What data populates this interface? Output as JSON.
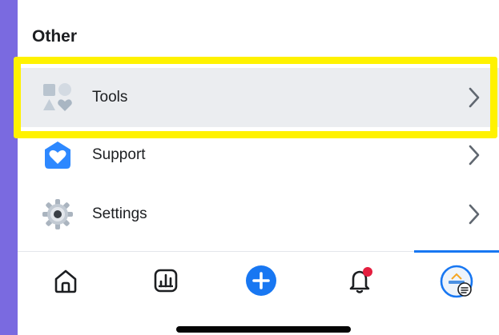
{
  "section": {
    "title": "Other"
  },
  "menu": [
    {
      "label": "Tools",
      "icon": "tools-shapes-icon"
    },
    {
      "label": "Support",
      "icon": "support-heart-house-icon"
    },
    {
      "label": "Settings",
      "icon": "settings-gear-icon"
    }
  ],
  "tabbar": {
    "tabs": [
      {
        "name": "home",
        "icon": "home-icon"
      },
      {
        "name": "insights",
        "icon": "insights-chart-icon"
      },
      {
        "name": "create",
        "icon": "plus-circle-icon"
      },
      {
        "name": "notifications",
        "icon": "bell-icon",
        "badge": true
      },
      {
        "name": "profile",
        "icon": "profile-avatar-icon",
        "active": true
      }
    ]
  },
  "colors": {
    "accent": "#1877f2",
    "highlight": "#fff200",
    "badge": "#e41e3f",
    "background": "#7a6ae0"
  }
}
